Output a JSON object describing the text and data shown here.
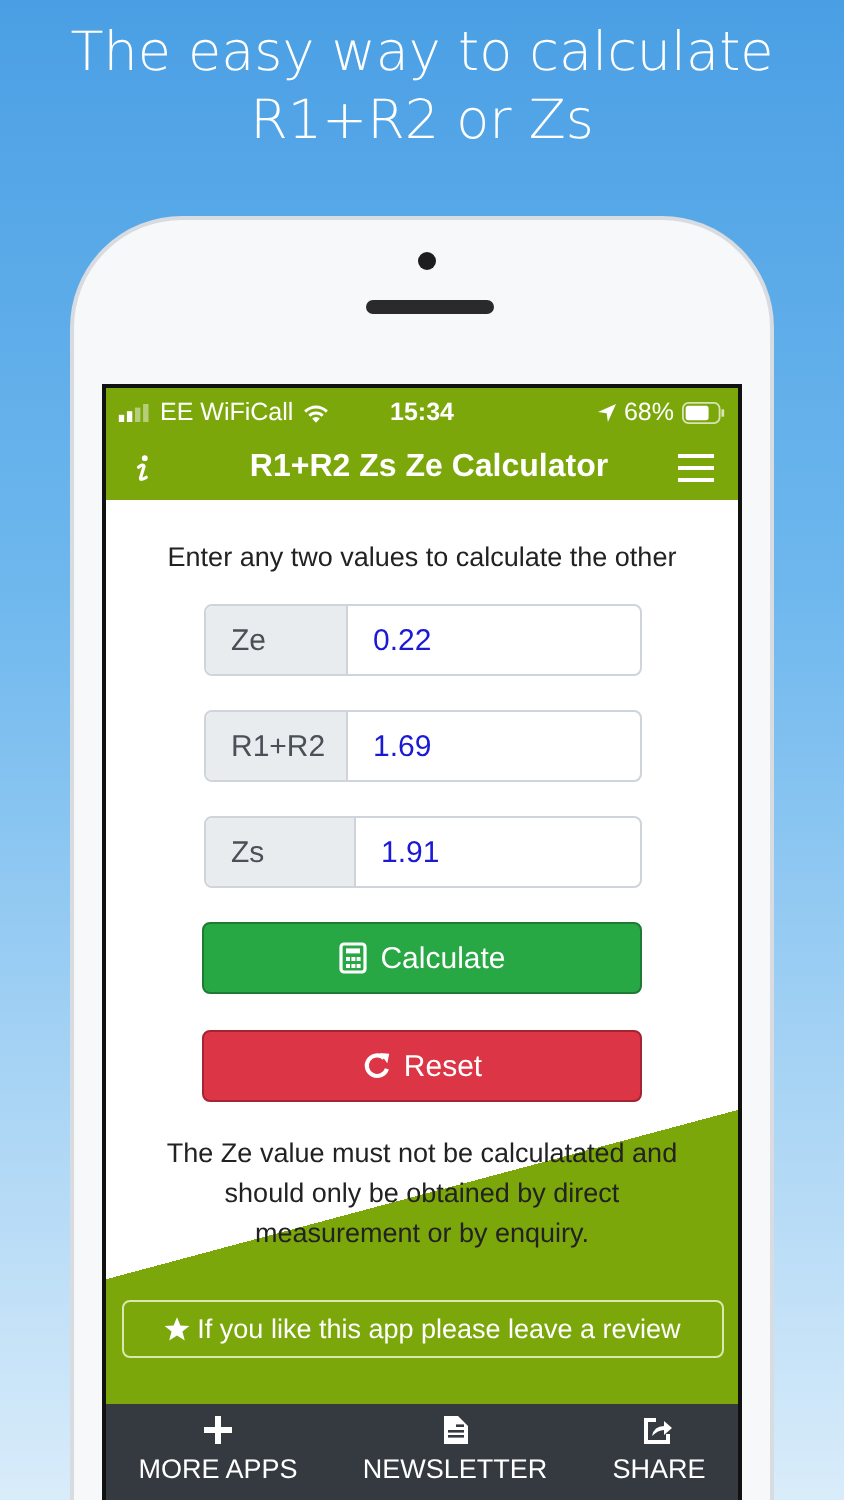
{
  "headline": [
    "The easy way to calculate",
    "R1+R2 or Zs"
  ],
  "status_bar": {
    "carrier": "EE WiFiCall",
    "time": "15:34",
    "battery": "68%"
  },
  "header": {
    "title": "R1+R2 Zs Ze Calculator"
  },
  "instruction": "Enter any two values to calculate the other",
  "fields": [
    {
      "label": "Ze",
      "value": "0.22"
    },
    {
      "label": "R1+R2",
      "value": "1.69"
    },
    {
      "label": "Zs",
      "value": "1.91"
    }
  ],
  "buttons": [
    {
      "kind": "calculate",
      "label": "Calculate"
    },
    {
      "kind": "reset",
      "label": "Reset"
    }
  ],
  "note": "The Ze value must not be calculatated and should only be obtained by direct measurement or by enquiry.",
  "review": "If you like this app please leave a review",
  "footer": [
    {
      "kind": "plus",
      "label": "MORE APPS"
    },
    {
      "kind": "doc",
      "label": "NEWSLETTER"
    },
    {
      "kind": "share",
      "label": "SHARE"
    }
  ]
}
